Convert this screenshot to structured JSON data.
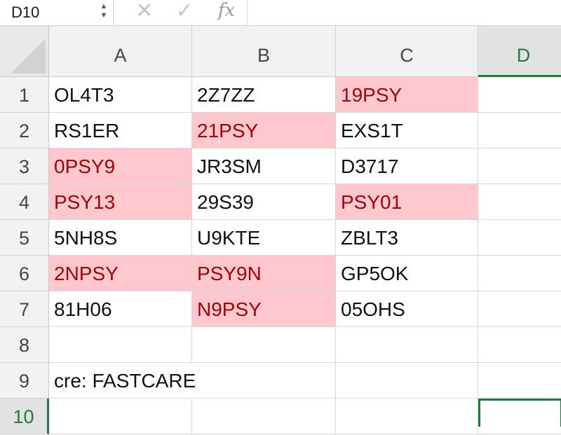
{
  "name_box": {
    "value": "D10",
    "arrows": "▲▼"
  },
  "formula_bar": {
    "cancel_icon": "✕",
    "confirm_icon": "✓",
    "fx_label": "fx"
  },
  "columns": [
    "A",
    "B",
    "C",
    "D"
  ],
  "active_column": "D",
  "rows": [
    "1",
    "2",
    "3",
    "4",
    "5",
    "6",
    "7",
    "8",
    "9",
    "10"
  ],
  "active_row": "10",
  "cells": {
    "A1": "OL4T3",
    "B1": "2Z7ZZ",
    "C1": "19PSY",
    "A2": "RS1ER",
    "B2": "21PSY",
    "C2": "EXS1T",
    "A3": "0PSY9",
    "B3": "JR3SM",
    "C3": "D3717",
    "A4": "PSY13",
    "B4": "29S39",
    "C4": "PSY01",
    "A5": "5NH8S",
    "B5": "U9KTE",
    "C5": "ZBLT3",
    "A6": "2NPSY",
    "B6": "PSY9N",
    "C6": "GP5OK",
    "A7": "81H06",
    "B7": "N9PSY",
    "C7": "05OHS",
    "A9": "cre: FASTCARE"
  },
  "highlighted_cells": [
    "C1",
    "B2",
    "A3",
    "A4",
    "C4",
    "A6",
    "B6",
    "B7"
  ],
  "colors": {
    "highlight_fill": "#ffc7ce",
    "highlight_text": "#9c0006",
    "selection_accent": "#1d7a40"
  }
}
